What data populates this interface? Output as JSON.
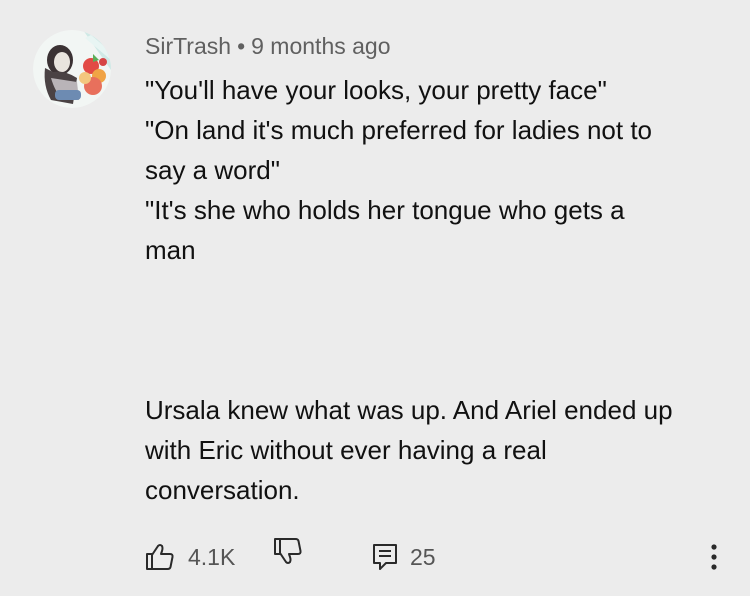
{
  "comment": {
    "author": "SirTrash",
    "separator": "•",
    "timestamp": "9 months ago",
    "lines": [
      "\"You'll have your looks, your pretty face\"",
      "\"On land it's much preferred for ladies not to",
      "say a word\"",
      "\"It's she who holds her tongue who gets a",
      "man"
    ],
    "lines2": [
      "Ursala knew what was up. And Ariel ended up",
      "with Eric without ever having a real",
      "conversation."
    ]
  },
  "actions": {
    "like_icon": "thumbs-up-icon",
    "like_count": "4.1K",
    "dislike_icon": "thumbs-down-icon",
    "reply_icon": "reply-comment-icon",
    "reply_count": "25",
    "more_icon": "more-vertical-icon"
  },
  "colors": {
    "background": "#ececec",
    "text": "#111111",
    "meta_text": "#606060"
  }
}
